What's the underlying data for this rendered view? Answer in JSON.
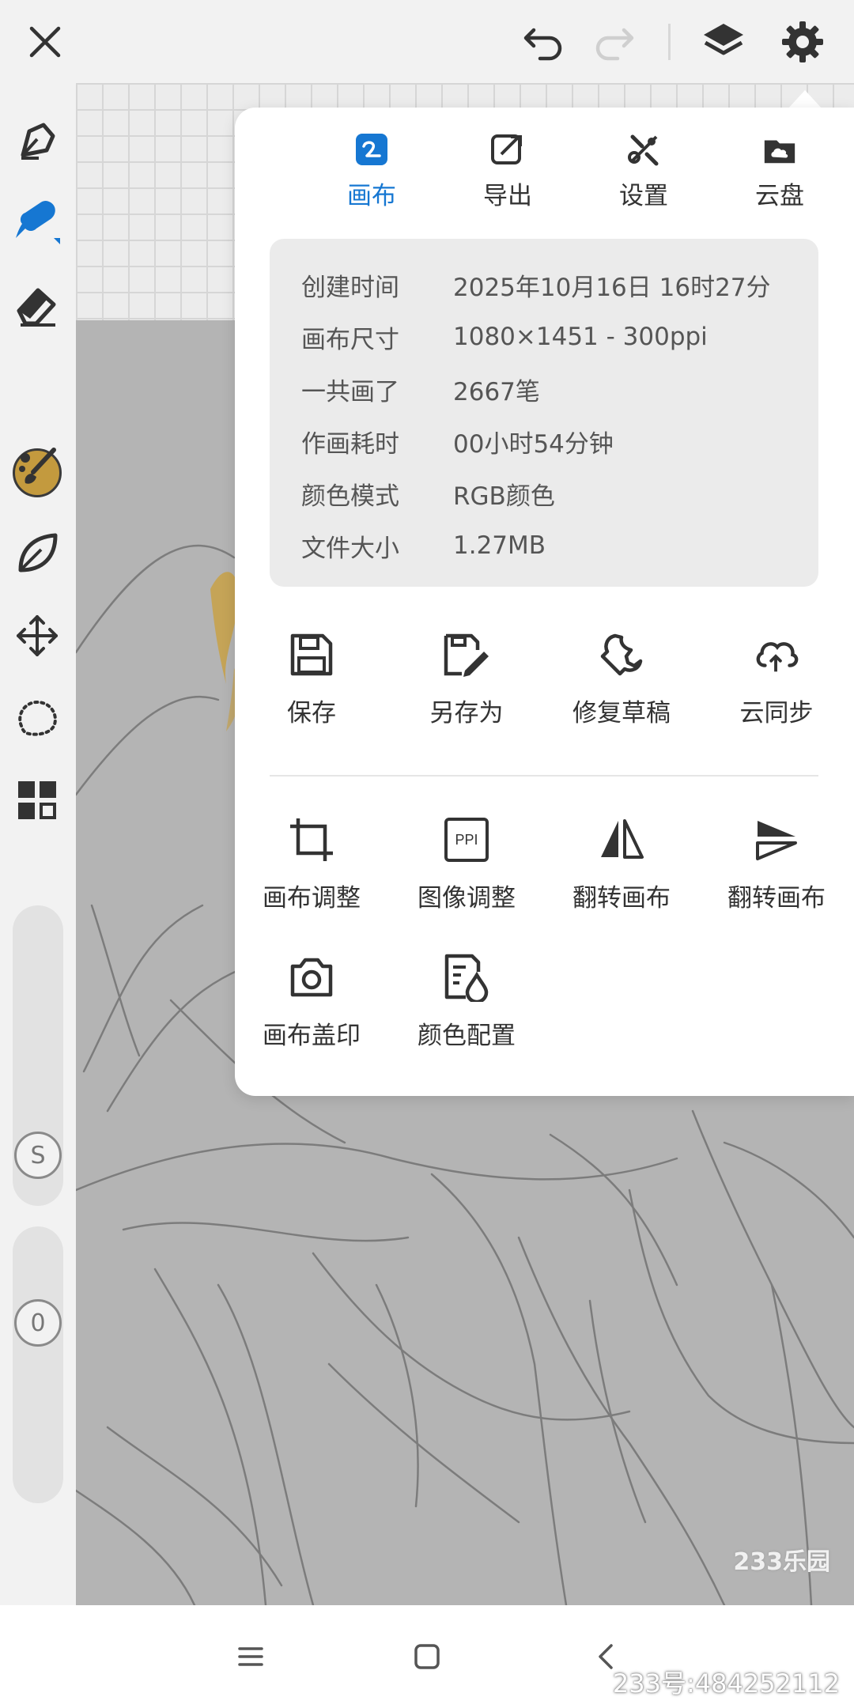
{
  "topbar": {
    "close_icon": "close-icon",
    "undo_icon": "undo-icon",
    "redo_icon": "redo-icon",
    "layers_icon": "layers-icon",
    "settings_icon": "gear-icon"
  },
  "rail": {
    "tools": [
      "pen-icon",
      "brush-icon",
      "eraser-icon",
      "smudge-icon",
      "leaf-icon",
      "move-icon",
      "lasso-icon",
      "grid-icon"
    ],
    "current_color": "#c39a3e",
    "size_knob_label": "S",
    "opacity_knob_label": "0"
  },
  "panel": {
    "tabs": [
      {
        "label": "画布",
        "icon": "canvas-icon",
        "active": true
      },
      {
        "label": "导出",
        "icon": "export-icon",
        "active": false
      },
      {
        "label": "设置",
        "icon": "settings-icon",
        "active": false
      },
      {
        "label": "云盘",
        "icon": "cloud-drive-icon",
        "active": false
      }
    ],
    "info": [
      {
        "key": "创建时间",
        "value": "2025年10月16日 16时27分"
      },
      {
        "key": "画布尺寸",
        "value": "1080×1451 - 300ppi"
      },
      {
        "key": "一共画了",
        "value": "2667笔"
      },
      {
        "key": "作画耗时",
        "value": "00小时54分钟"
      },
      {
        "key": "颜色模式",
        "value": "RGB颜色"
      },
      {
        "key": "文件大小",
        "value": "1.27MB"
      }
    ],
    "file_actions": [
      {
        "label": "保存",
        "icon": "save-icon"
      },
      {
        "label": "另存为",
        "icon": "save-as-icon"
      },
      {
        "label": "修复草稿",
        "icon": "wrench-icon"
      },
      {
        "label": "云同步",
        "icon": "cloud-sync-icon"
      }
    ],
    "canvas_actions": [
      {
        "label": "画布调整",
        "icon": "crop-icon"
      },
      {
        "label": "图像调整",
        "icon": "ppi-icon",
        "icon_text": "PPI"
      },
      {
        "label": "翻转画布",
        "icon": "flip-horizontal-icon"
      },
      {
        "label": "翻转画布",
        "icon": "flip-vertical-icon"
      },
      {
        "label": "画布盖印",
        "icon": "camera-icon"
      },
      {
        "label": "颜色配置",
        "icon": "color-config-icon"
      }
    ]
  },
  "navbar": {
    "menu_icon": "menu-icon",
    "home_icon": "home-icon",
    "back_icon": "back-icon"
  },
  "watermark": {
    "logo": "233乐园",
    "id_text": "233号:484252112"
  },
  "colors": {
    "accent": "#1677d2",
    "brush_blue": "#1677d2",
    "canvas_gray": "#b4b4b4",
    "panel_bg": "#ffffff",
    "info_bg": "#ebebeb"
  }
}
